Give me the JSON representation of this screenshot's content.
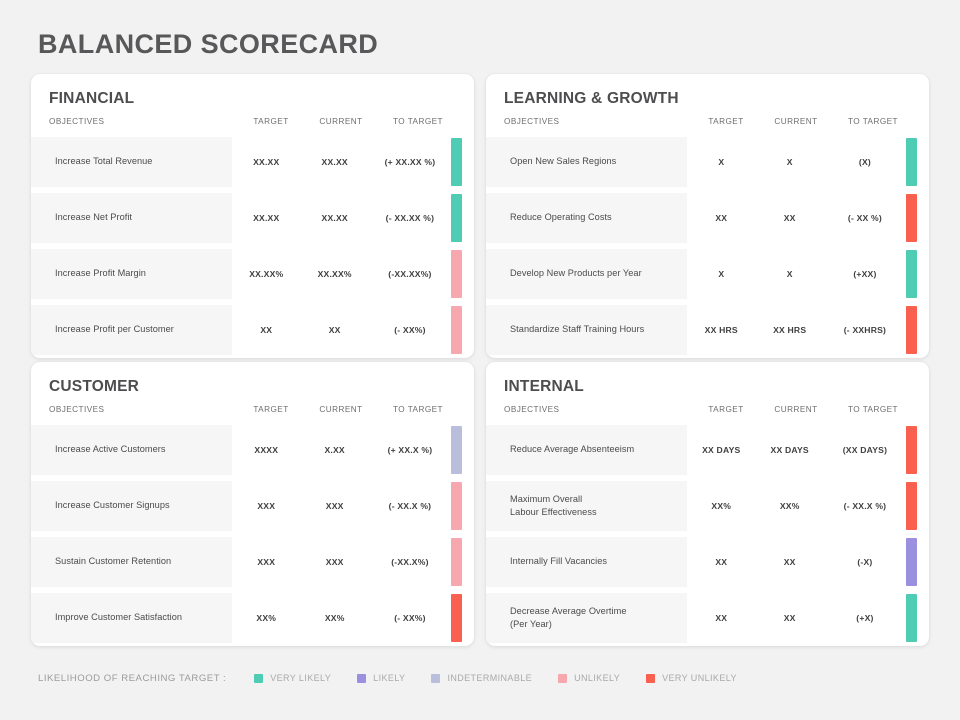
{
  "page": {
    "title": "BALANCED SCORECARD",
    "background_color": "#f2f2f2",
    "title_color": "#58585a"
  },
  "columns": {
    "objectives": "OBJECTIVES",
    "target": "TARGET",
    "current": "CURRENT",
    "to_target": "TO TARGET"
  },
  "status_colors": {
    "very_likely": "#4ecdb4",
    "likely": "#9b8fe0",
    "indeterminable": "#b9bedd",
    "unlikely": "#f7a8ae",
    "very_unlikely": "#f9604f"
  },
  "cards": [
    {
      "title": "FINANCIAL",
      "rows": [
        {
          "objective": "Increase Total Revenue",
          "target": "XX.XX",
          "current": "XX.XX",
          "to_target": "(+ XX.XX %)",
          "status": "very_likely",
          "status_color": "#4ecdb4"
        },
        {
          "objective": "Increase Net Profit",
          "target": "XX.XX",
          "current": "XX.XX",
          "to_target": "(- XX.XX %)",
          "status": "very_likely",
          "status_color": "#4ecdb4"
        },
        {
          "objective": "Increase Profit Margin",
          "target": "XX.XX%",
          "current": "XX.XX%",
          "to_target": "(-XX.XX%)",
          "status": "unlikely",
          "status_color": "#f7a8ae"
        },
        {
          "objective": "Increase Profit per Customer",
          "target": "XX",
          "current": "XX",
          "to_target": "(- XX%)",
          "status": "unlikely",
          "status_color": "#f7a8ae"
        }
      ]
    },
    {
      "title": "LEARNING & GROWTH",
      "rows": [
        {
          "objective": "Open New Sales Regions",
          "target": "X",
          "current": "X",
          "to_target": "(X)",
          "status": "very_likely",
          "status_color": "#4ecdb4"
        },
        {
          "objective": "Reduce Operating Costs",
          "target": "XX",
          "current": "XX",
          "to_target": "(- XX %)",
          "status": "very_unlikely",
          "status_color": "#f9604f"
        },
        {
          "objective": "Develop New Products per Year",
          "target": "X",
          "current": "X",
          "to_target": "(+XX)",
          "status": "very_likely",
          "status_color": "#4ecdb4"
        },
        {
          "objective": "Standardize Staff Training Hours",
          "target": "XX HRS",
          "current": "XX HRS",
          "to_target": "(- XXHRS)",
          "status": "very_unlikely",
          "status_color": "#f9604f"
        }
      ]
    },
    {
      "title": "CUSTOMER",
      "rows": [
        {
          "objective": "Increase Active Customers",
          "target": "XXXX",
          "current": "X.XX",
          "to_target": "(+ XX.X %)",
          "status": "indeterminable",
          "status_color": "#b9bedd"
        },
        {
          "objective": "Increase Customer Signups",
          "target": "XXX",
          "current": "XXX",
          "to_target": "(- XX.X %)",
          "status": "unlikely",
          "status_color": "#f7a8ae"
        },
        {
          "objective": "Sustain Customer Retention",
          "target": "XXX",
          "current": "XXX",
          "to_target": "(-XX.X%)",
          "status": "unlikely",
          "status_color": "#f7a8ae"
        },
        {
          "objective": "Improve Customer Satisfaction",
          "target": "XX%",
          "current": "XX%",
          "to_target": "(- XX%)",
          "status": "very_unlikely",
          "status_color": "#f9604f"
        }
      ]
    },
    {
      "title": "INTERNAL",
      "rows": [
        {
          "objective": "Reduce Average Absenteeism",
          "target": "XX DAYS",
          "current": "XX DAYS",
          "to_target": "(XX DAYS)",
          "status": "very_unlikely",
          "status_color": "#f9604f"
        },
        {
          "objective": "Maximum Overall\nLabour Effectiveness",
          "target": "XX%",
          "current": "XX%",
          "to_target": "(- XX.X %)",
          "status": "very_unlikely",
          "status_color": "#f9604f"
        },
        {
          "objective": "Internally Fill Vacancies",
          "target": "XX",
          "current": "XX",
          "to_target": "(-X)",
          "status": "likely",
          "status_color": "#9b8fe0"
        },
        {
          "objective": "Decrease Average Overtime\n(Per Year)",
          "target": "XX",
          "current": "XX",
          "to_target": "(+X)",
          "status": "very_likely",
          "status_color": "#4ecdb4"
        }
      ]
    }
  ],
  "legend": {
    "label": "LIKELIHOOD OF REACHING TARGET :",
    "items": [
      {
        "text": "VERY LIKELY",
        "color": "#4ecdb4"
      },
      {
        "text": "LIKELY",
        "color": "#9b8fe0"
      },
      {
        "text": "INDETERMINABLE",
        "color": "#b9bedd"
      },
      {
        "text": "UNLIKELY",
        "color": "#f7a8ae"
      },
      {
        "text": "VERY UNLIKELY",
        "color": "#f9604f"
      }
    ]
  }
}
